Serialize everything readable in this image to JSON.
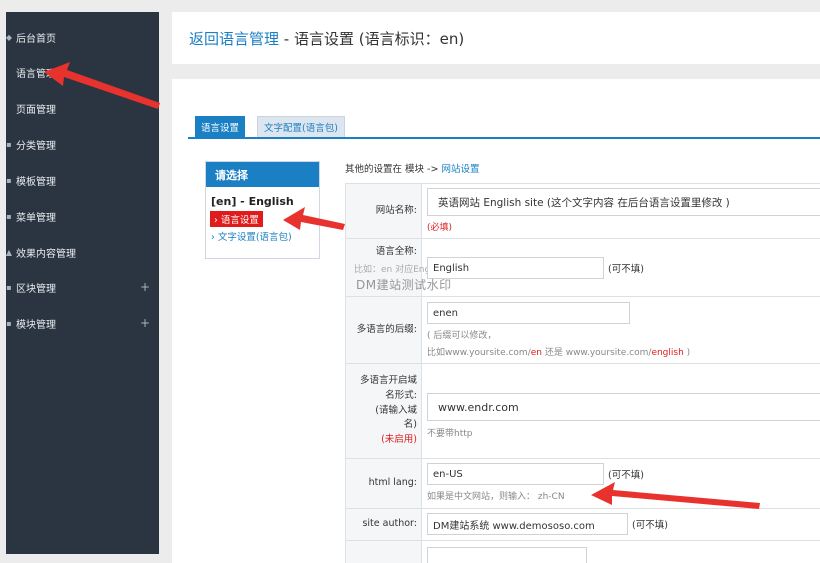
{
  "sidebar": {
    "items": [
      {
        "label": "后台首页",
        "icon": "home-icon",
        "plus": ""
      },
      {
        "label": "语言管理",
        "icon": "",
        "plus": ""
      },
      {
        "label": "页面管理",
        "icon": "",
        "plus": ""
      },
      {
        "label": "分类管理",
        "icon": "category-icon",
        "plus": ""
      },
      {
        "label": "模板管理",
        "icon": "template-icon",
        "plus": ""
      },
      {
        "label": "菜单管理",
        "icon": "menu-icon",
        "plus": ""
      },
      {
        "label": "效果内容管理",
        "icon": "effect-icon",
        "plus": ""
      },
      {
        "label": "区块管理",
        "icon": "block-icon",
        "plus": "+"
      },
      {
        "label": "模块管理",
        "icon": "module-icon",
        "plus": "+"
      }
    ]
  },
  "header": {
    "back_link": "返回语言管理",
    "title": " - 语言设置 (语言标识：en)"
  },
  "tabs": [
    "语言设置",
    "文字配置(语言包)"
  ],
  "selector": {
    "heading": "请选择",
    "language": "[en] - English",
    "current": "语言设置",
    "link": "文字设置(语言包)"
  },
  "other_settings": {
    "prefix": "其他的设置在 模块 -> ",
    "link": "网站设置"
  },
  "form": {
    "site_name": {
      "label": "网站名称:",
      "value": "英语网站 English site (这个文字内容 在后台语言设置里修改 )",
      "required": "(必填)"
    },
    "full_name": {
      "label": "语言全称:",
      "placeholder": "比如：en 对应English",
      "value": "English",
      "optional": "(可不填)"
    },
    "suffix": {
      "label": "多语言的后缀:",
      "value": "enen",
      "hint1": "( 后缀可以修改，",
      "hint2a": "比如www.yoursite.com/",
      "hint2b": "en",
      "hint2c": " 还是 www.yoursite.com/",
      "hint2d": "english",
      "hint2e": " )"
    },
    "domain": {
      "label": "多语言开启域名形式:",
      "label_sub": "(请输入域名)",
      "disabled": "(未启用)",
      "value": "www.endr.com",
      "hint": "不要带http"
    },
    "html_lang": {
      "label": "html lang:",
      "value": "en-US",
      "optional": "(可不填)",
      "hint": "如果是中文网站，则输入： zh-CN"
    },
    "site_author": {
      "label": "site author:",
      "value": "DM建站系统 www.demososo.com",
      "optional": "(可不填)"
    }
  },
  "watermark": "DM建站测试水印",
  "colors": {
    "accent": "#1b7fc4",
    "sidebar": "#2b3541",
    "alert_red": "#e01b1b",
    "arrow_red": "#e8322e"
  }
}
